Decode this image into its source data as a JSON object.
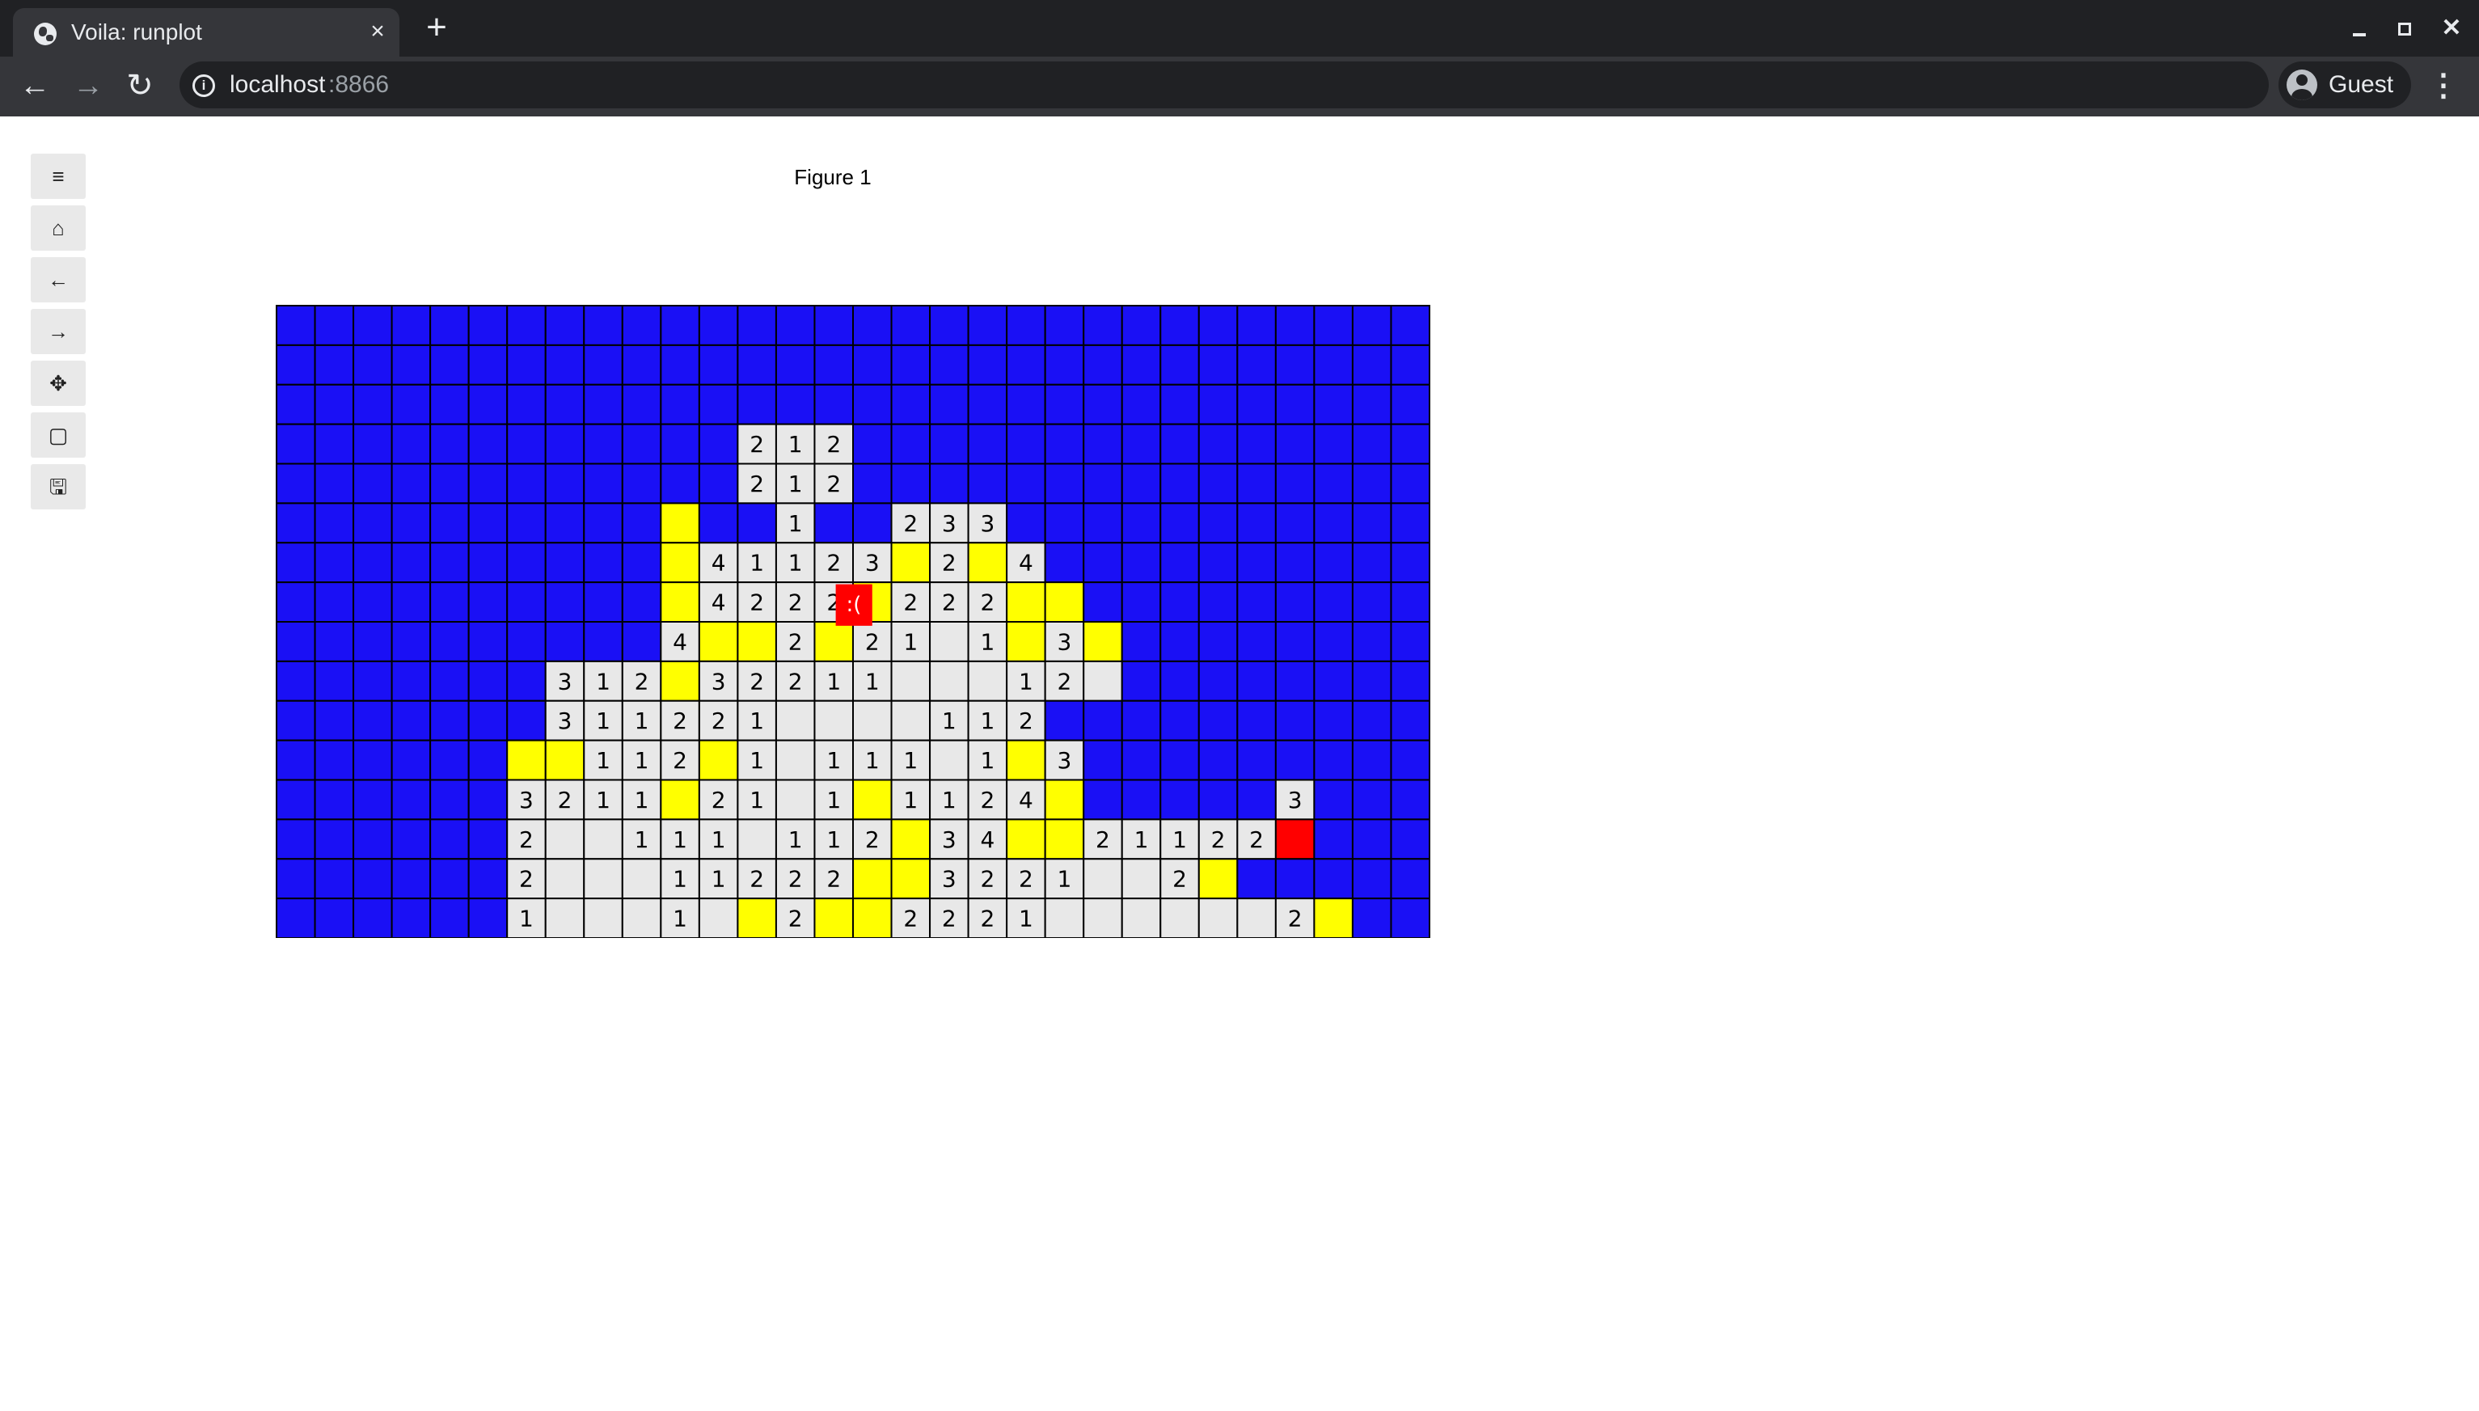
{
  "browser": {
    "tab_title": "Voila: runplot",
    "tab_close": "×",
    "new_tab": "+",
    "url_host": "localhost",
    "url_port": ":8866",
    "profile_label": "Guest"
  },
  "figure": {
    "title": "Figure 1",
    "toolbar": [
      {
        "name": "menu-icon",
        "glyph": "≡"
      },
      {
        "name": "home-icon",
        "glyph": "⌂"
      },
      {
        "name": "back-arrow-icon",
        "glyph": "←"
      },
      {
        "name": "forward-arrow-icon",
        "glyph": "→"
      },
      {
        "name": "pan-move-icon",
        "glyph": "✥"
      },
      {
        "name": "zoom-rectangle-icon",
        "glyph": "▢"
      },
      {
        "name": "save-icon",
        "glyph": "🖫"
      }
    ]
  },
  "board": {
    "cols": 30,
    "rows": 16,
    "colors": {
      "hidden": "#1a10f5",
      "revealed": "#e8e8e8",
      "flag": "#ffff00",
      "mine": "#ff0000",
      "grid": "#000000"
    },
    "legend_codes": {
      "B": "hidden",
      "0": "revealed empty",
      "1-8": "revealed count",
      "Y": "flagged",
      "R": "mine"
    },
    "cells": [
      "BBBBBBBBBBBBBBBBBBBBBBBBBBBBBB",
      "BBBBBBBBBBBBBBBBBBBBBBBBBBBBBB",
      "BBBBBBBBBBBBBBBBBBBBBBBBBBBBBB",
      "BBBBBBBBBBBB212BBBBBBBBBBBBBBB",
      "BBBBBBBBBBBB212BBBBBBBBBBBBBBB",
      "BBBBBBBBBBYBB1BB233BBBBBBBBBBB",
      "BBBBBBBBBBY41123Y2Y4BBBBBBBBBB",
      "BBBBBBBBBBY4222Y222YYBBBBBBBBB",
      "BBBBBBBBBB4YY2Y2101Y3YBBBBBBBBB",
      "BBBBBBB312Y32211000120BBBBBBBB",
      "BBBBBBB3112210000112BBBBBBBBBB",
      "BBBBBBYY112Y1011101Y3BBBBBBBBB",
      "BBBBBB3211Y2101Y1124YBBBBB3BBB",
      "BBBBBB2001110112Y34YY21122RBBB",
      "BBBBBB200011222YY3221002YBBBBB",
      "BBBBBB100010Y2YY22210000002YBBB"
    ],
    "sad_face_label": ":(",
    "sad_face_anchor": {
      "row": 7,
      "col": 15
    }
  }
}
